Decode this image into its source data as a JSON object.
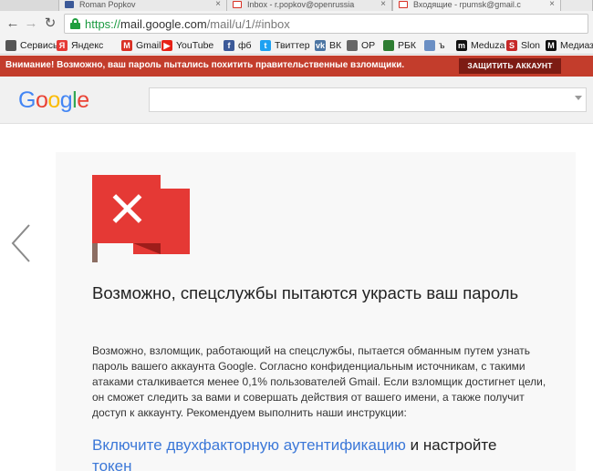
{
  "tabs": [
    {
      "label": "Roman Popkov",
      "favicon_color": "#3b5998"
    },
    {
      "label": "Inbox - r.popkov@openrussia",
      "favicon_color": "#d93025"
    },
    {
      "label": "Входящие - rpumsk@gmail.c",
      "favicon_color": "#d93025"
    }
  ],
  "omnibox": {
    "secure": "https://",
    "host": "mail.google.com",
    "path": "/mail/u/1/#inbox"
  },
  "bookmarks": [
    {
      "label": "Сервисы",
      "icon": "apps-grid-icon",
      "color": "#555555"
    },
    {
      "label": "Яндекс",
      "icon": "yandex-icon",
      "color": "#e53935",
      "glyph": "Я"
    },
    {
      "label": "Gmail",
      "icon": "gmail-icon",
      "color": "#d93025",
      "glyph": "M"
    },
    {
      "label": "YouTube",
      "icon": "youtube-icon",
      "color": "#e62117",
      "glyph": "▶"
    },
    {
      "label": "фб",
      "icon": "facebook-icon",
      "color": "#3b5998",
      "glyph": "f"
    },
    {
      "label": "Твиттер",
      "icon": "twitter-icon",
      "color": "#1da1f2",
      "glyph": "t"
    },
    {
      "label": "ВК",
      "icon": "vk-icon",
      "color": "#4c75a3",
      "glyph": "vk"
    },
    {
      "label": "OP",
      "icon": "op-icon",
      "color": "#666666",
      "glyph": ""
    },
    {
      "label": "РБК",
      "icon": "rbk-icon",
      "color": "#2e7d32",
      "glyph": ""
    },
    {
      "label": "ъ",
      "icon": "kommersant-icon",
      "color": "#6a8fc4",
      "glyph": ""
    },
    {
      "label": "Meduza",
      "icon": "meduza-icon",
      "color": "#111111",
      "glyph": "m"
    },
    {
      "label": "Slon",
      "icon": "slon-icon",
      "color": "#c62828",
      "glyph": "S"
    },
    {
      "label": "Медиаз",
      "icon": "mediazona-icon",
      "color": "#111111",
      "glyph": "M"
    }
  ],
  "warning": {
    "text": "Внимание! Возможно, ваш пароль пытались похитить правительственные взломщики.",
    "button": "ЗАЩИТИТЬ АККАУНТ"
  },
  "google_logo": [
    {
      "ch": "G",
      "color": "#4285f4"
    },
    {
      "ch": "o",
      "color": "#ea4335"
    },
    {
      "ch": "o",
      "color": "#fbbc05"
    },
    {
      "ch": "g",
      "color": "#4285f4"
    },
    {
      "ch": "l",
      "color": "#34a853"
    },
    {
      "ch": "e",
      "color": "#ea4335"
    }
  ],
  "main": {
    "title": "Возможно, спецслужбы пытаются украсть ваш пароль",
    "paragraph": "Возможно, взломщик, работающий на спецслужбы, пытается обманным путем узнать пароль вашего аккаунта Google. Согласно конфиденциальным источникам, с такими атаками сталкивается менее 0,1% пользователей Gmail. Если взломщик достигнет цели, он сможет следить за вами и совершать действия от вашего имени, а также получит доступ к аккаунту. Рекомендуем выполнить наши инструкции:",
    "step_link": "Включите двухфакторную аутентификацию",
    "step_rest": " и настройте",
    "step_link2": "токен"
  },
  "colors": {
    "warning_bg": "#c33d2c",
    "button_bg": "#7d1c14",
    "flag": "#e53935",
    "link": "#3c78d8"
  }
}
